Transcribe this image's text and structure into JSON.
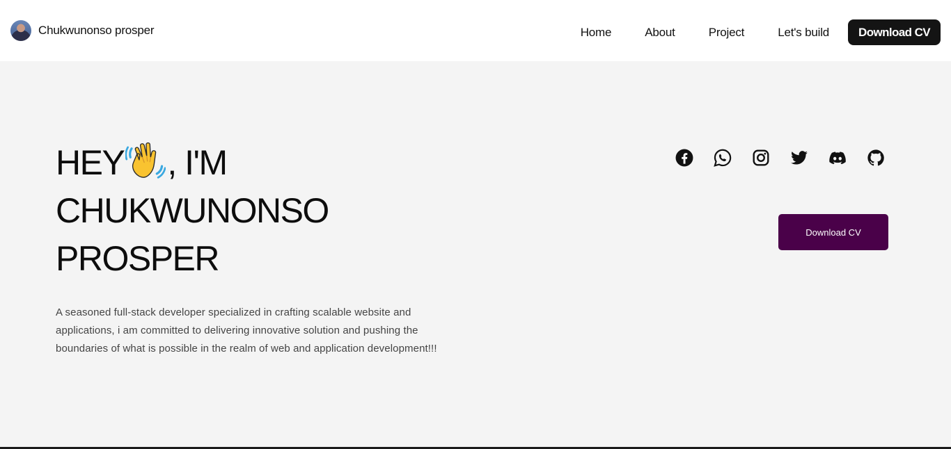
{
  "nav": {
    "brand_name": "Chukwunonso prosper",
    "links": [
      "Home",
      "About",
      "Project",
      "Let's build"
    ],
    "cv_button": "Download CV"
  },
  "hero": {
    "title_line1_before": "HEY",
    "title_line1_after": ", I'M",
    "title_line2": "CHUKWUNONSO",
    "title_line3": "PROSPER",
    "wave_icon": "waving-hand-icon",
    "description": "A seasoned full-stack developer specialized in crafting scalable website and applications, i am committed to delivering innovative solution and pushing the boundaries of what is possible in the realm of web and application development!!!",
    "cv_button": "Download CV"
  },
  "socials": [
    "facebook-icon",
    "whatsapp-icon",
    "instagram-icon",
    "twitter-icon",
    "discord-icon",
    "github-icon"
  ],
  "colors": {
    "nav_background": "#ffffff",
    "page_background": "#f4f4f4",
    "nav_cv_background": "#141414",
    "hero_cv_background": "#4a0149",
    "text": "#111111"
  }
}
